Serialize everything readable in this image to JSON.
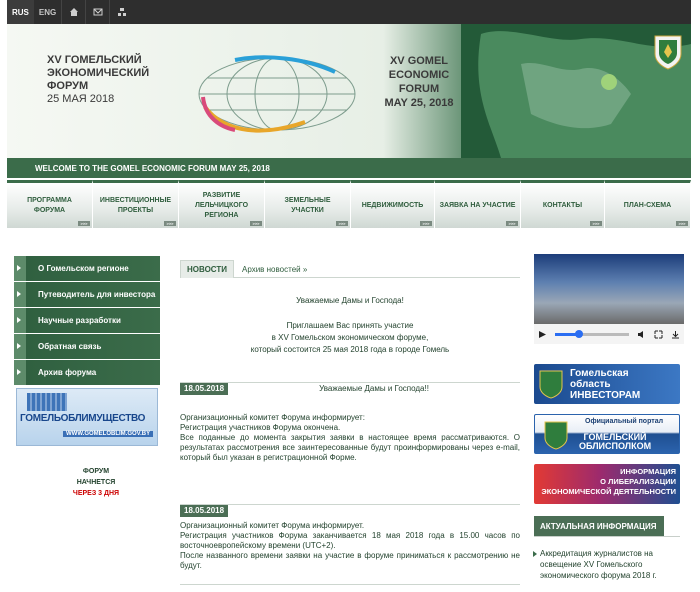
{
  "topbar": {
    "lang_ru": "RUS",
    "lang_en": "ENG",
    "icons": [
      "home-icon",
      "mail-icon",
      "sitemap-icon"
    ]
  },
  "banner": {
    "ru_line1": "XV ГОМЕЛЬСКИЙ",
    "ru_line2": "ЭКОНОМИЧЕСКИЙ",
    "ru_line3": "ФОРУМ",
    "ru_date": "25 МАЯ 2018",
    "en_line1": "XV GOMEL",
    "en_line2": "ECONOMIC",
    "en_line3": "FORUM",
    "en_date": "MAY 25, 2018",
    "welcome": "WELCOME TO THE GOMEL ECONOMIC FORUM MAY 25, 2018"
  },
  "nav": {
    "items": [
      {
        "label": "ПРОГРАММА ФОРУМА"
      },
      {
        "label": "ИНВЕСТИЦИОННЫЕ ПРОЕКТЫ"
      },
      {
        "label": "РАЗВИТИЕ ЛЕЛЬЧИЦКОГО РЕГИОНА"
      },
      {
        "label": "ЗЕМЕЛЬНЫЕ УЧАСТКИ"
      },
      {
        "label": "НЕДВИЖИМОСТЬ"
      },
      {
        "label": "ЗАЯВКА НА УЧАСТИЕ"
      },
      {
        "label": "КОНТАКТЫ"
      },
      {
        "label": "ПЛАН-СХЕМА"
      }
    ],
    "more_label": ">>>"
  },
  "left_menu": {
    "items": [
      {
        "label": "О Гомельском регионе"
      },
      {
        "label": "Путеводитель для инвестора"
      },
      {
        "label": "Научные разработки"
      },
      {
        "label": "Обратная связь"
      },
      {
        "label": "Архив форума"
      }
    ],
    "imu_banner": {
      "title": "ГОМЕЛЬОБЛИМУЩЕСТВО",
      "url": "WWW.GOMELOBLIM.GOV.BY"
    },
    "countdown": {
      "line1": "ФОРУМ",
      "line2": "НАЧНЕТСЯ",
      "line3": "ЧЕРЕЗ 3 ДНЯ"
    }
  },
  "center": {
    "tab_news": "НОВОСТИ",
    "tab_archive": "Архив новостей »",
    "greeting": "Уважаемые Дамы и Господа!",
    "invite_line1": "Приглашаем Вас принять участие",
    "invite_line2": "в XV Гомельском экономическом форуме,",
    "invite_line3": "который состоится 25 мая 2018 года в городе Гомель",
    "news": [
      {
        "date": "18.05.2018",
        "title": "Уважаемые Дамы и Господа!!",
        "text1": "Организационный комитет Форума информирует:",
        "text2": "Регистрация участников Форума окончена.",
        "text3": "Все поданные до момента закрытия заявки в настоящее время рассматриваются. О результатах рассмотрения все заинтересованные будут проинформированы через e-mail, который был указан в регистрационной Форме."
      },
      {
        "date": "18.05.2018",
        "title": "",
        "text1": "Организационный комитет Форума информирует.",
        "text2": "Регистрация участников Форума заканчивается 18 мая 2018 года в 15.00 часов по восточноевропейскому времени (UTC+2).",
        "text3": "После названного времени заявки на участие в форуме приниматься к рассмотрению не будут."
      }
    ]
  },
  "right": {
    "banner1": {
      "line1": "Гомельская",
      "line2": "область",
      "line3": "ИНВЕСТОРАМ"
    },
    "banner2": {
      "line1": "Официальный портал",
      "line2": "ГОМЕЛЬСКИЙ",
      "line3": "ОБЛИСПОЛКОМ"
    },
    "banner3": {
      "line1": "ИНФОРМАЦИЯ",
      "line2": "О ЛИБЕРАЛИЗАЦИИ",
      "line3": "ЭКОНОМИЧЕСКОЙ ДЕЯТЕЛЬНОСТИ"
    },
    "actual_title": "АКТУАЛЬНАЯ ИНФОРМАЦИЯ",
    "actual_item": "Аккредитация журналистов на освещение XV Гомельского экономического форума 2018 г."
  },
  "colors": {
    "brand_green": "#3b6c4a",
    "link_blue": "#1b4a8f",
    "countdown_red": "#c00000"
  }
}
